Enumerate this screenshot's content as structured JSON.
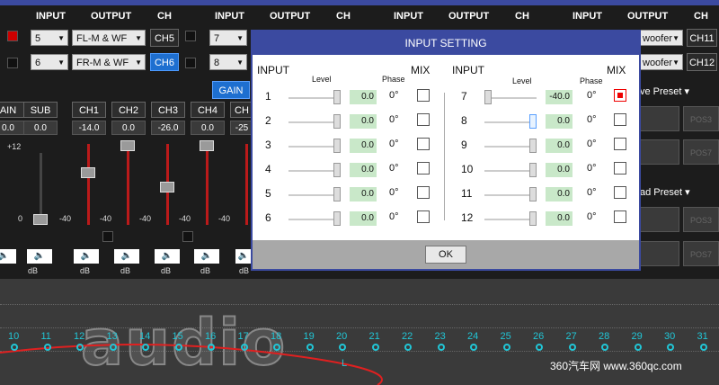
{
  "colors": {
    "accent": "#3b4aa0",
    "selected": "#1e6fd0",
    "slider_red": "#bb1a1a",
    "freq": "#21c6d6"
  },
  "header": {
    "input": "INPUT",
    "output": "OUTPUT",
    "ch": "CH"
  },
  "routing": {
    "groups": [
      {
        "rows": [
          {
            "input": "5",
            "output": "FL-M & WF",
            "ch": "CH5",
            "selected": false
          },
          {
            "input": "6",
            "output": "FR-M & WF",
            "ch": "CH6",
            "selected": true
          }
        ]
      },
      {
        "rows": [
          {
            "input": "7",
            "ch": ""
          },
          {
            "input": "8",
            "ch": ""
          }
        ]
      },
      {
        "rows": [
          {
            "output": "woofer",
            "ch": "CH11"
          },
          {
            "output": "woofer",
            "ch": "CH12"
          }
        ]
      }
    ]
  },
  "gain_label": "GAIN",
  "mixer": {
    "channels": [
      {
        "name": "AIN",
        "value": "0.0"
      },
      {
        "name": "SUB",
        "value": "0.0"
      },
      {
        "name": "CH1",
        "value": "-14.0"
      },
      {
        "name": "CH2",
        "value": "0.0"
      },
      {
        "name": "CH3",
        "value": "-26.0"
      },
      {
        "name": "CH4",
        "value": "0.0"
      },
      {
        "name": "CH",
        "value": "-25"
      }
    ],
    "scale_top": "+12",
    "scale_zero": "0",
    "scale_bottom": "-40",
    "unit": "dB"
  },
  "presets": {
    "save": "ve Preset",
    "load": "ad Preset",
    "pos": [
      "POS3",
      "POS7",
      "POS3",
      "POS7"
    ]
  },
  "graph": {
    "freq_labels": [
      "10",
      "11",
      "12",
      "13",
      "14",
      "15",
      "16",
      "17",
      "18",
      "19",
      "20",
      "21",
      "22",
      "23",
      "24",
      "25",
      "26",
      "27",
      "28",
      "29",
      "30",
      "31"
    ],
    "marker": "L"
  },
  "logo": "audio",
  "watermark": "360汽车网 www.360qc.com",
  "dialog": {
    "title": "INPUT SETTING",
    "left": {
      "input": "INPUT",
      "level": "Level",
      "phase": "Phase",
      "mix": "MIX",
      "rows": [
        {
          "n": "1",
          "value": "0.0",
          "phase": "0°",
          "mix": false,
          "level_db": 0
        },
        {
          "n": "2",
          "value": "0.0",
          "phase": "0°",
          "mix": false,
          "level_db": 0
        },
        {
          "n": "3",
          "value": "0.0",
          "phase": "0°",
          "mix": false,
          "level_db": 0
        },
        {
          "n": "4",
          "value": "0.0",
          "phase": "0°",
          "mix": false,
          "level_db": 0
        },
        {
          "n": "5",
          "value": "0.0",
          "phase": "0°",
          "mix": false,
          "level_db": 0
        },
        {
          "n": "6",
          "value": "0.0",
          "phase": "0°",
          "mix": false,
          "level_db": 0
        }
      ]
    },
    "right": {
      "input": "INPUT",
      "level": "Level",
      "phase": "Phase",
      "mix": "MIX",
      "rows": [
        {
          "n": "7",
          "value": "-40.0",
          "phase": "0°",
          "mix": true,
          "level_db": -40
        },
        {
          "n": "8",
          "value": "0.0",
          "phase": "0°",
          "mix": false,
          "level_db": 0
        },
        {
          "n": "9",
          "value": "0.0",
          "phase": "0°",
          "mix": false,
          "level_db": 0
        },
        {
          "n": "10",
          "value": "0.0",
          "phase": "0°",
          "mix": false,
          "level_db": 0
        },
        {
          "n": "11",
          "value": "0.0",
          "phase": "0°",
          "mix": false,
          "level_db": 0
        },
        {
          "n": "12",
          "value": "0.0",
          "phase": "0°",
          "mix": false,
          "level_db": 0
        }
      ]
    },
    "ok": "OK"
  }
}
